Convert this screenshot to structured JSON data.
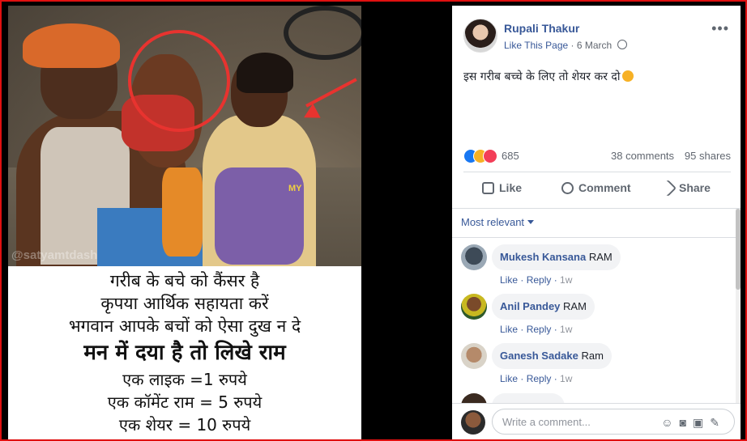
{
  "photo": {
    "watermark": "@satyamtdash",
    "watermark2": "MY",
    "caption_lines": [
      "गरीब के बचे को कैंसर है",
      "कृपया आर्थिक सहायता करें",
      "भगवान आपके बचों को ऐसा दुख न दे",
      "मन में दया है तो लिखे राम",
      "एक लाइक =1 रुपये",
      "एक कॉमेंट राम = 5 रुपये",
      "एक शेयर = 10 रुपये"
    ]
  },
  "post": {
    "author": "Rupali Thakur",
    "like_page": "Like This Page",
    "date": "6 March",
    "more": "•••",
    "text": "इस गरीब बच्चे के लिए तो शेयर कर दो",
    "reaction_count": "685",
    "comments_count": "38 comments",
    "shares_count": "95 shares",
    "actions": {
      "like": "Like",
      "comment": "Comment",
      "share": "Share"
    }
  },
  "comments": {
    "sort_label": "Most relevant",
    "items": [
      {
        "name": "Mukesh Kansana",
        "text": "RAM",
        "like": "Like",
        "reply": "Reply",
        "time": "1w"
      },
      {
        "name": "Anil Pandey",
        "text": "RAM",
        "like": "Like",
        "reply": "Reply",
        "time": "1w"
      },
      {
        "name": "Ganesh Sadake",
        "text": "Ram",
        "like": "Like",
        "reply": "Reply",
        "time": "1w"
      }
    ],
    "reply_placeholder": "Write a comment..."
  },
  "colors": {
    "border": "#e01010",
    "fb_link": "#385898"
  }
}
